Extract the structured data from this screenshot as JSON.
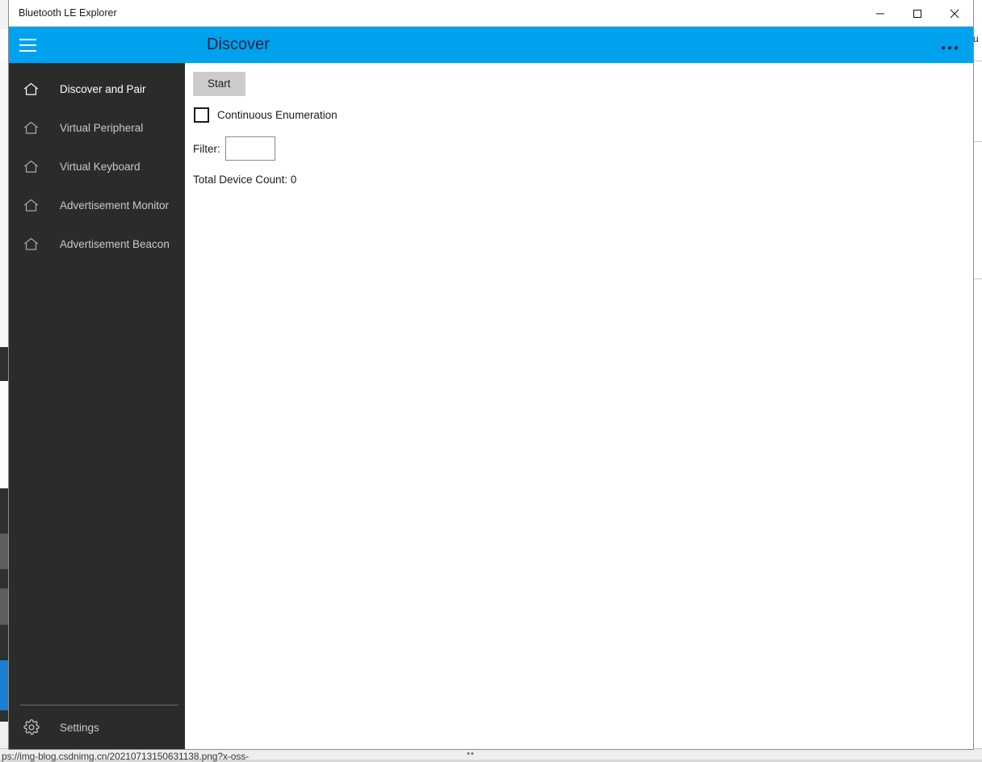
{
  "window": {
    "title": "Bluetooth LE Explorer",
    "controls": {
      "minimize_label": "Minimize",
      "maximize_label": "Maximize",
      "close_label": "Close"
    }
  },
  "commandbar": {
    "menu_label": "Menu",
    "page_title": "Discover",
    "more_label": "•••",
    "accent_color": "#00a2ed",
    "title_color": "#17264a"
  },
  "navigation": {
    "items": [
      {
        "label": "Discover and Pair",
        "icon": "home-icon",
        "selected": true
      },
      {
        "label": "Virtual Peripheral",
        "icon": "home-icon",
        "selected": false
      },
      {
        "label": "Virtual Keyboard",
        "icon": "home-icon",
        "selected": false
      },
      {
        "label": "Advertisement Monitor",
        "icon": "home-icon",
        "selected": false
      },
      {
        "label": "Advertisement Beacon",
        "icon": "home-icon",
        "selected": false
      }
    ],
    "settings": {
      "label": "Settings",
      "icon": "gear-icon"
    },
    "background_color": "#2b2b2b"
  },
  "discover": {
    "start_button": "Start",
    "continuous_enumeration_label": "Continuous Enumeration",
    "continuous_enumeration_checked": false,
    "filter_label": "Filter:",
    "filter_value": "",
    "filter_placeholder": "",
    "total_device_count": "Total Device Count: 0"
  },
  "background": {
    "right_edge_text": "u",
    "bottom_url": "ps://img-blog.csdnimg.cn/20210713150631138.png?x-oss-",
    "bottom_dots": "••"
  }
}
